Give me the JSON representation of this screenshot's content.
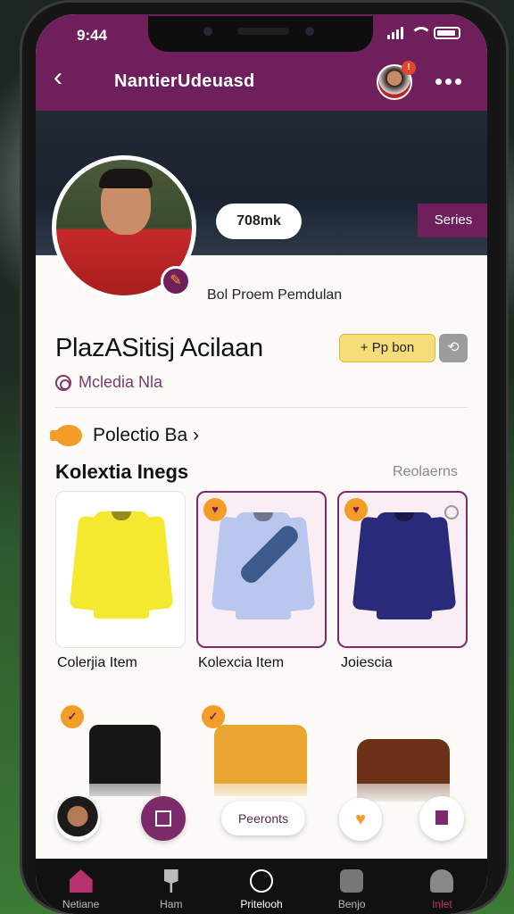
{
  "status": {
    "time": "9:44"
  },
  "header": {
    "title": "NantierUdeuasd",
    "notif_count": "!"
  },
  "profile": {
    "followers_pill": "708mk",
    "series_button": "Series",
    "subtitle": "Bol Proem Pemdulan",
    "name": "PlazASitisj Acilaan",
    "follow_label": "+ Pp bon",
    "handle": "Mcledia Nla"
  },
  "collection_link": "Polectio Ba ›",
  "section": {
    "title": "Kolextia Inegs",
    "link": "Reolaerns"
  },
  "items": [
    {
      "caption": "Colerjia Item",
      "color": "#f5e92f",
      "trim": "#1a1a1a"
    },
    {
      "caption": "Kolexcia Item",
      "color": "#b9c6ee",
      "trim": "#3e5a8a"
    },
    {
      "caption": "Joiescia",
      "color": "#2a2a7a",
      "trim": "#d23b6b"
    }
  ],
  "bottom_items": [
    {
      "color": "#161616",
      "trim": "#b91d1d"
    },
    {
      "color": "#e8a531",
      "trim": "#7a4a22"
    },
    {
      "color": "#6b3218",
      "trim": "#444"
    }
  ],
  "float_bar": {
    "pill": "Peeronts"
  },
  "tabs": [
    {
      "label": "Netiane"
    },
    {
      "label": "Ham"
    },
    {
      "label": "Pritelooh"
    },
    {
      "label": "Benjo"
    },
    {
      "label": "Inlet"
    }
  ],
  "colors": {
    "brand": "#6e1f5c",
    "accent": "#f39c27"
  }
}
